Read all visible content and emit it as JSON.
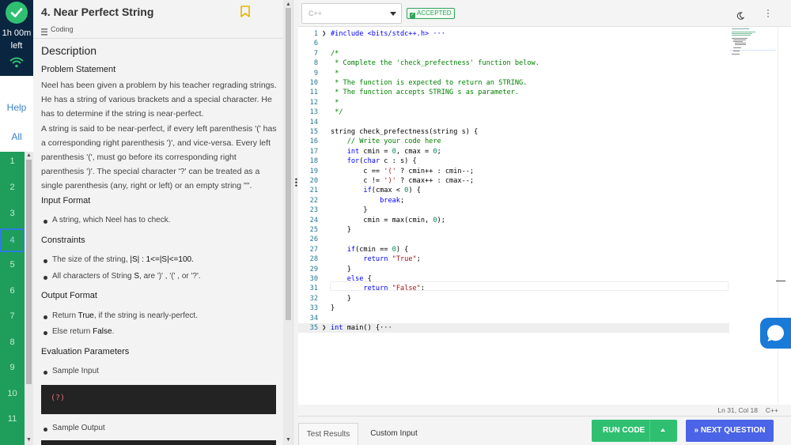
{
  "sidebar": {
    "timer": "1h 00m",
    "timer_suffix": "left",
    "help": "Help",
    "all": "All",
    "questions": [
      "1",
      "2",
      "3",
      "4",
      "5",
      "6",
      "7",
      "8",
      "9",
      "10",
      "11"
    ],
    "active_question": "4"
  },
  "question": {
    "title": "4. Near Perfect String",
    "category": "Coding",
    "description_heading": "Description",
    "problem_statement_heading": "Problem Statement",
    "problem_p1": "Neel has been given a problem by his teacher regrading strings. He has a string of various brackets and a special character. He has to determine if the string is near-perfect.",
    "problem_p2": "A string is said to be near-perfect, if every left parenthesis '(' has a corresponding right parenthesis ')', and vice-versa. Every left parenthesis '(', must go before its corresponding right parenthesis ')'. The special character '?' can be treated as a single parenthesis (any, right or left) or an empty string \"\".",
    "input_format_heading": "Input Format",
    "input_bullet": "A string, which Neel has to check.",
    "constraints_heading": "Constraints",
    "constraint_1_pre": "The size of the string,",
    "constraint_1_strong": "|S| : 1<=|S|<=100.",
    "constraint_2_pre": "All characters of String",
    "constraint_2_strong": "S",
    "constraint_2_post": ", are ')' , '(' , or '?'.",
    "output_format_heading": "Output Format",
    "output_1_pre": "Return",
    "output_1_strong": "True",
    "output_1_post": ", if the string is nearly-perfect.",
    "output_2_pre": "Else return",
    "output_2_strong": "False",
    "output_2_post": ".",
    "evaluation_heading": "Evaluation Parameters",
    "sample_input_label": "Sample Input",
    "sample_input_value": "(?)",
    "sample_output_label": "Sample Output"
  },
  "editor": {
    "language": "C++",
    "status_badge": "ACCEPTED",
    "cursor_position": "Ln 31, Col 18",
    "status_language": "C++",
    "lines": [
      {
        "n": "1",
        "text": "#include <bits/stdc++.h> ···",
        "kind": "pre",
        "fold": true
      },
      {
        "n": "6",
        "text": "",
        "kind": "plain"
      },
      {
        "n": "7",
        "text": "/*",
        "kind": "comment"
      },
      {
        "n": "8",
        "text": " * Complete the 'check_prefectness' function below.",
        "kind": "comment"
      },
      {
        "n": "9",
        "text": " *",
        "kind": "comment"
      },
      {
        "n": "10",
        "text": " * The function is expected to return an STRING.",
        "kind": "comment"
      },
      {
        "n": "11",
        "text": " * The function accepts STRING s as parameter.",
        "kind": "comment"
      },
      {
        "n": "12",
        "text": " *",
        "kind": "comment"
      },
      {
        "n": "13",
        "text": " */",
        "kind": "comment"
      },
      {
        "n": "14",
        "text": "",
        "kind": "plain"
      },
      {
        "n": "15",
        "text": "string check_prefectness(string s) {",
        "kind": "plain"
      },
      {
        "n": "16",
        "text": "    // Write your code here",
        "kind": "comment"
      },
      {
        "n": "17",
        "text": "    int cmin = 0, cmax = 0;",
        "kind": "plain"
      },
      {
        "n": "18",
        "text": "    for(char c : s) {",
        "kind": "plain"
      },
      {
        "n": "19",
        "text": "        c == '(' ? cmin++ : cmin--;",
        "kind": "plain"
      },
      {
        "n": "20",
        "text": "        c != ')' ? cmax++ : cmax--;",
        "kind": "plain"
      },
      {
        "n": "21",
        "text": "        if(cmax < 0) {",
        "kind": "plain"
      },
      {
        "n": "22",
        "text": "            break;",
        "kind": "plain"
      },
      {
        "n": "23",
        "text": "        }",
        "kind": "plain"
      },
      {
        "n": "24",
        "text": "        cmin = max(cmin, 0);",
        "kind": "plain"
      },
      {
        "n": "25",
        "text": "    }",
        "kind": "plain"
      },
      {
        "n": "26",
        "text": "",
        "kind": "plain"
      },
      {
        "n": "27",
        "text": "    if(cmin == 0) {",
        "kind": "plain"
      },
      {
        "n": "28",
        "text": "        return \"True\";",
        "kind": "plain"
      },
      {
        "n": "29",
        "text": "    }",
        "kind": "plain"
      },
      {
        "n": "30",
        "text": "    else {",
        "kind": "plain"
      },
      {
        "n": "31",
        "text": "        return \"False\";",
        "kind": "plain"
      },
      {
        "n": "32",
        "text": "    }",
        "kind": "plain"
      },
      {
        "n": "33",
        "text": "}",
        "kind": "plain"
      },
      {
        "n": "34",
        "text": "",
        "kind": "plain"
      },
      {
        "n": "35",
        "text": "int main() {···",
        "kind": "plain",
        "fold": true
      }
    ]
  },
  "footer": {
    "tab_test_results": "Test Results",
    "tab_custom_input": "Custom Input",
    "run_code": "RUN CODE",
    "next_question": "» NEXT QUESTION"
  },
  "colors": {
    "accent_green": "#2fbf71",
    "next_blue": "#4a63e7",
    "rail_dark": "#0a2540",
    "accepted_green": "#2fa35a"
  }
}
